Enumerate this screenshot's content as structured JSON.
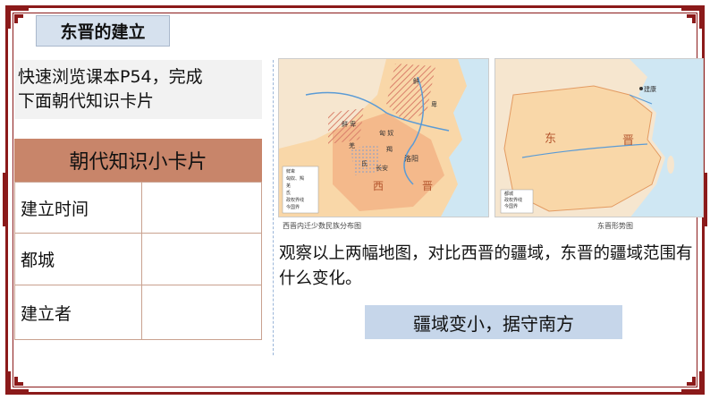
{
  "title": "东晋的建立",
  "instruction": {
    "line1": "快速浏览课本P54，完成",
    "line2": "下面朝代知识卡片"
  },
  "card": {
    "header": "朝代知识小卡片",
    "rows": [
      {
        "label": "建立时间",
        "value": ""
      },
      {
        "label": "都城",
        "value": ""
      },
      {
        "label": "建立者",
        "value": ""
      }
    ]
  },
  "map_left": {
    "caption": "西晋内迁少数民族分布图",
    "labels": {
      "xianbei": "鲜",
      "bei": "卑",
      "xi": "西",
      "jin": "晋",
      "luoyang": "洛阳",
      "changan": "长安",
      "xiong": "匈",
      "nu": "奴",
      "jie": "羯",
      "qiang": "羌",
      "di": "氐",
      "xianbei2": "鲜",
      "bei2": "卑"
    },
    "legend": [
      "鲜卑",
      "匈奴、羯",
      "羌",
      "氐",
      "政权界线",
      "今国界"
    ]
  },
  "map_right": {
    "caption": "东晋形势图",
    "labels": {
      "dong": "东",
      "jin": "晋",
      "jiankang": "建康"
    },
    "legend": [
      "都城",
      "政权界线",
      "今国界"
    ]
  },
  "question": "观察以上两幅地图，对比西晋的疆域，东晋的疆域范围有什么变化。",
  "answer": "疆域变小，据守南方",
  "colors": {
    "frame": "#8b1a1a",
    "card_header": "#c8856a",
    "answer_bg": "#c6d6ea",
    "title_bg": "#d6e1ee",
    "land": "#f9d7a8",
    "sea": "#cfe7f3"
  }
}
